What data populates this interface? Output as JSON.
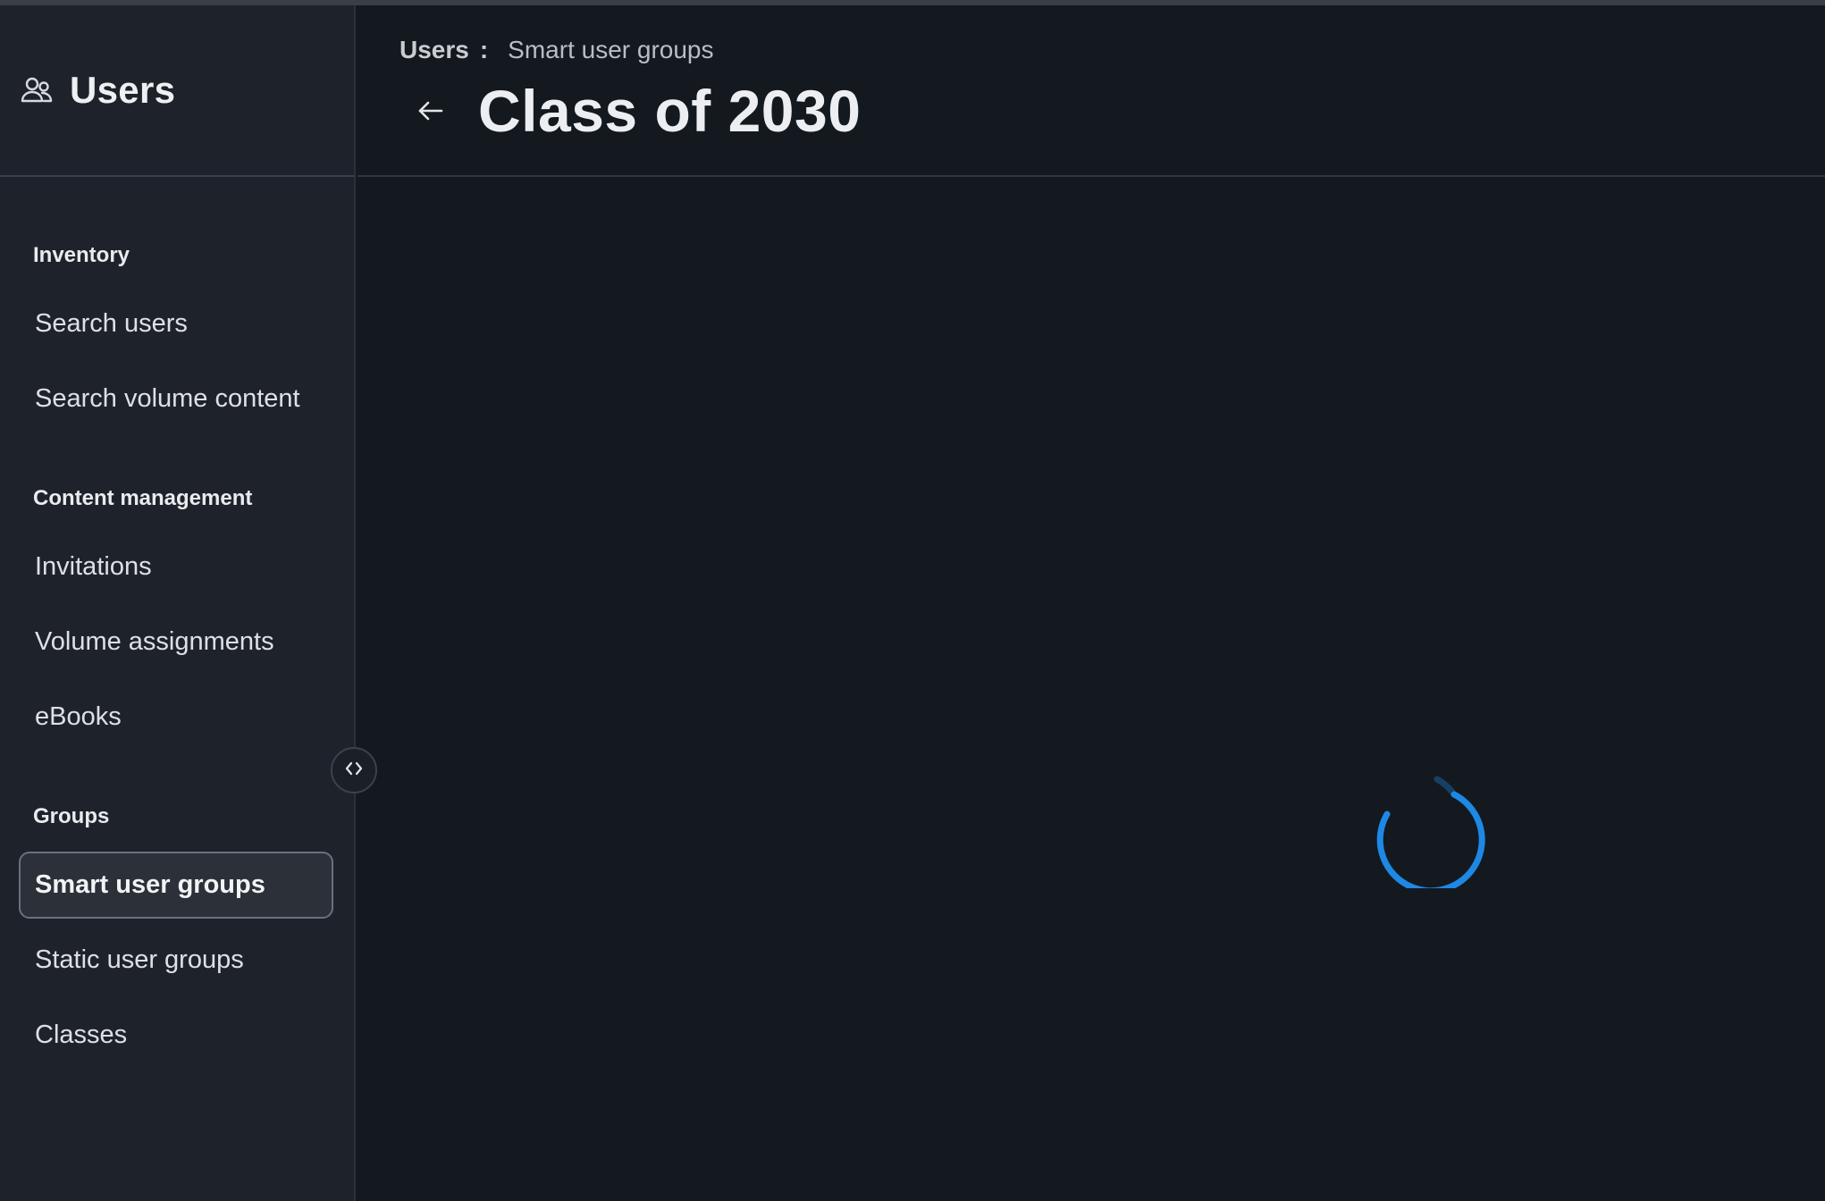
{
  "sidebar": {
    "title": "Users",
    "icon": "users-icon",
    "sections": [
      {
        "title": "Inventory",
        "items": [
          {
            "label": "Search users"
          },
          {
            "label": "Search volume content"
          }
        ]
      },
      {
        "title": "Content management",
        "items": [
          {
            "label": "Invitations"
          },
          {
            "label": "Volume assignments"
          },
          {
            "label": "eBooks"
          }
        ]
      },
      {
        "title": "Groups",
        "items": [
          {
            "label": "Smart user groups",
            "active": true
          },
          {
            "label": "Static user groups"
          },
          {
            "label": "Classes"
          }
        ]
      }
    ],
    "collapse_toggle_icon": "chevrons-left-right-icon"
  },
  "header": {
    "breadcrumb": {
      "root": "Users",
      "separator": ":",
      "current": "Smart user groups"
    },
    "back_icon": "arrow-left-icon",
    "title": "Class of 2030"
  },
  "main": {
    "state": "loading",
    "spinner_icon": "loading-spinner-icon"
  },
  "colors": {
    "background": "#141920",
    "sidebar_background": "#1e232b",
    "accent": "#1e88e5",
    "text": "#e6e8eb"
  }
}
